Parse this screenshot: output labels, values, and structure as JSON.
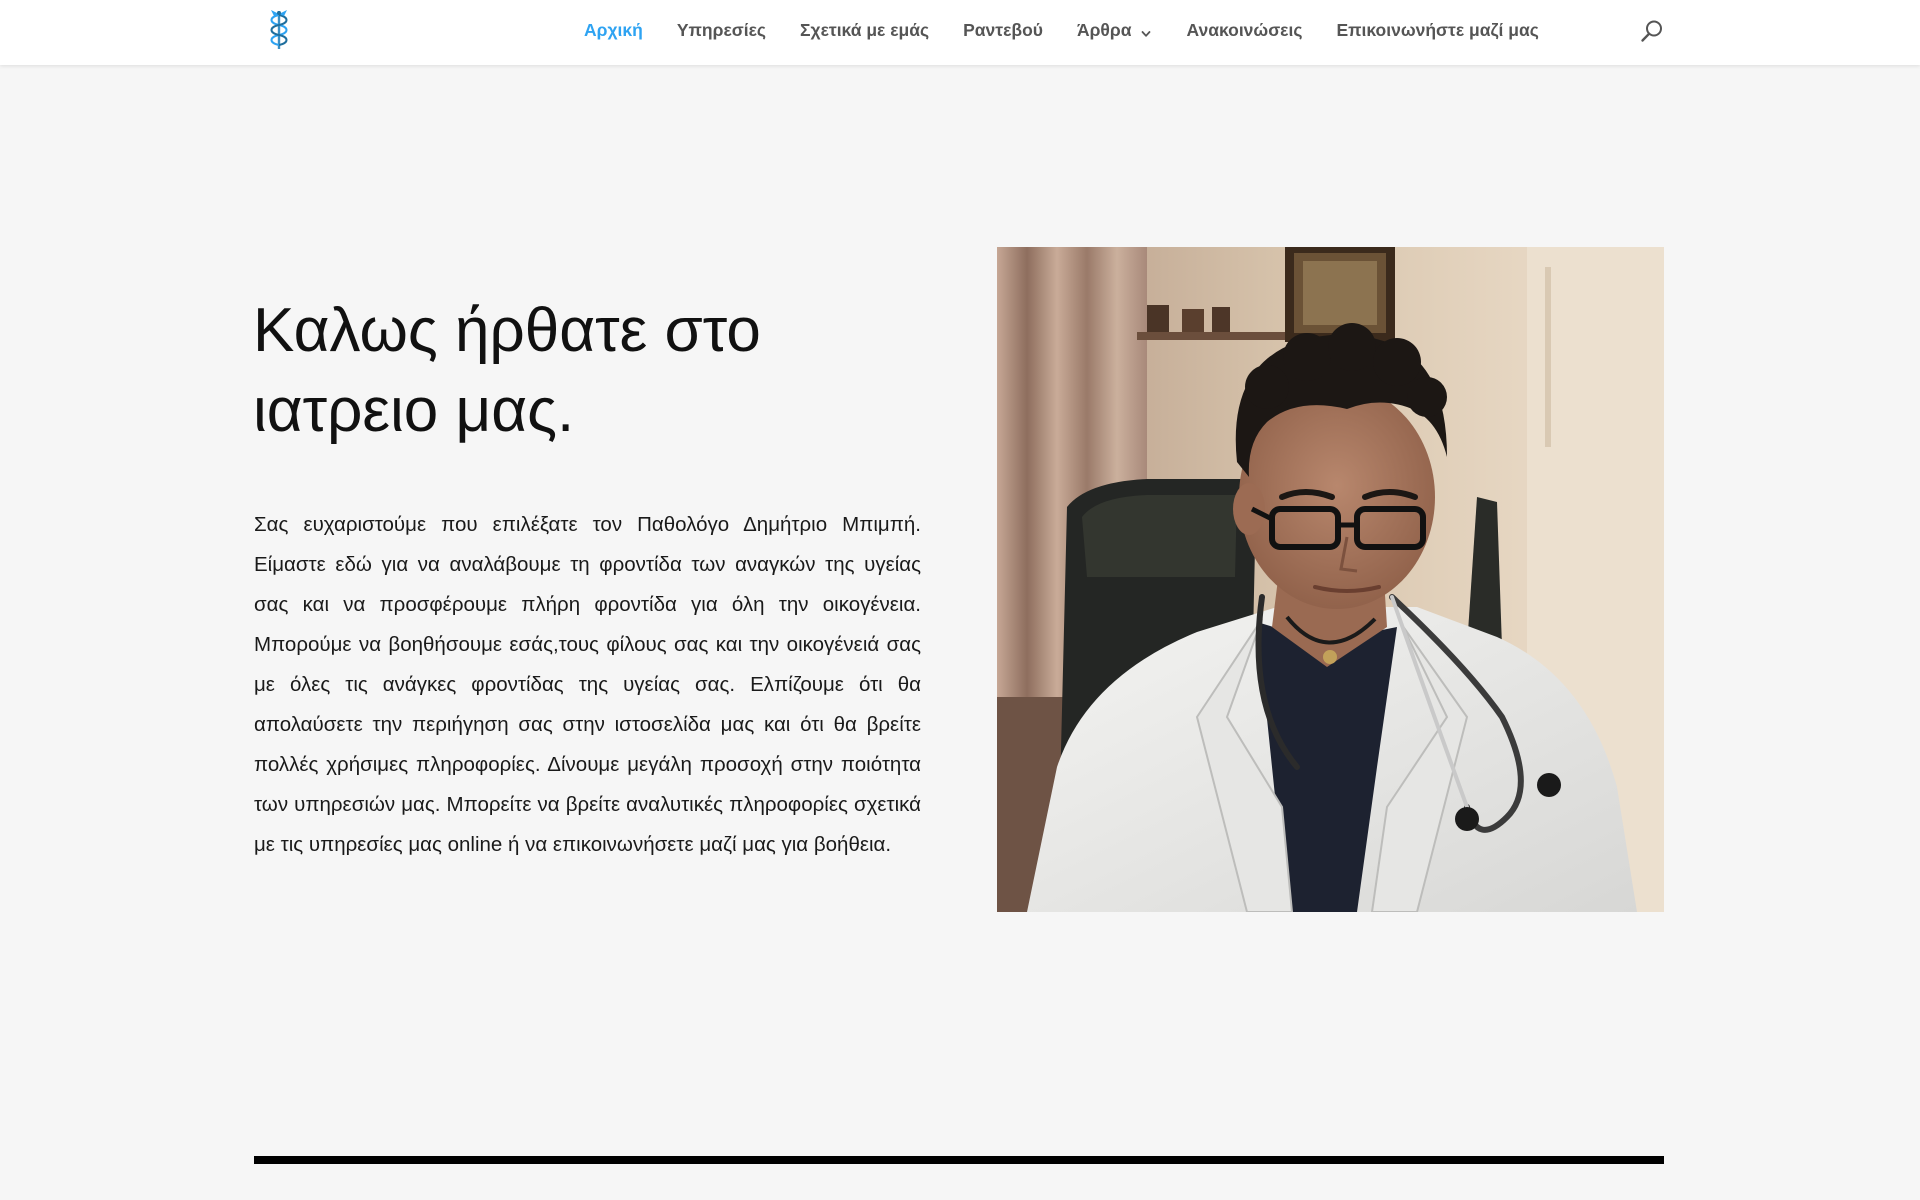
{
  "header": {
    "logo_icon": "caduceus-logo-icon",
    "nav": [
      {
        "label": "Αρχική",
        "active": true
      },
      {
        "label": "Υπηρεσίες",
        "active": false
      },
      {
        "label": "Σχετικά με εμάς",
        "active": false
      },
      {
        "label": "Ραντεβού",
        "active": false
      },
      {
        "label": "Άρθρα",
        "active": false,
        "has_dropdown": true
      },
      {
        "label": "Ανακοινώσεις",
        "active": false
      },
      {
        "label": "Επικοινωνήστε μαζί μας",
        "active": false
      }
    ],
    "search_icon": "search-icon"
  },
  "hero": {
    "title_line1": "Καλως ήρθατε στο",
    "title_line2": "ιατρειο μας.",
    "body": "Σας ευχαριστούμε που επιλέξατε τον Παθολόγο Δημήτριο Μπιμπή. Είμαστε εδώ για να αναλάβουμε τη φροντίδα των αναγκών της υγείας σας  και να προσφέρουμε πλήρη φροντίδα για όλη την οικογένεια.  Μπορούμε να βοηθήσουμε εσάς,τους φίλους σας και την οικογένειά σας με όλες τις ανάγκες φροντίδας της υγείας σας. Ελπίζουμε ότι θα απολαύσετε την περιήγηση σας στην ιστοσελίδα μας και ότι θα βρείτε πολλές χρήσιμες πληροφορίες. Δίνουμε μεγάλη προσοχή στην ποιότητα των υπηρεσιών μας. Μπορείτε να βρείτε αναλυτικές πληροφορίες σχετικά με τις υπηρεσίες μας online ή να επικοινωνήσετε μαζί μας για βοήθεια."
  },
  "colors": {
    "accent": "#2ea3f2",
    "nav_text": "#555555",
    "page_bg": "#f6f6f6",
    "divider": "#000000"
  }
}
